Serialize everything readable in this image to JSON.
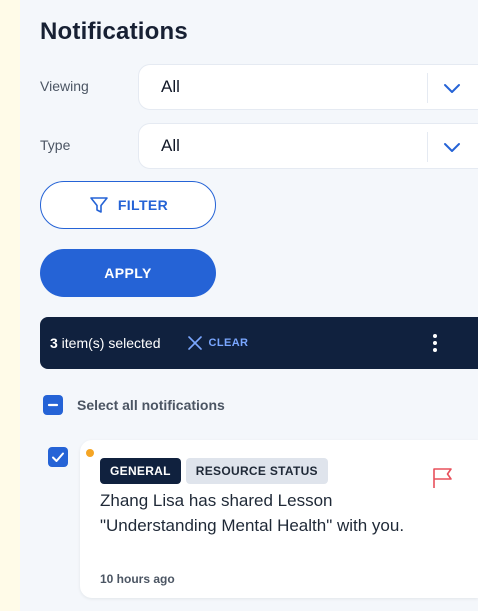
{
  "panel": {
    "title": "Notifications"
  },
  "filters": {
    "viewing": {
      "label": "Viewing",
      "value": "All"
    },
    "type": {
      "label": "Type",
      "value": "All"
    },
    "filter_button": "FILTER",
    "apply_button": "APPLY"
  },
  "selection_bar": {
    "count": "3",
    "suffix": " item(s) selected",
    "clear_label": "CLEAR"
  },
  "select_all": {
    "label": "Select all notifications",
    "state": "indeterminate"
  },
  "notifications": [
    {
      "checked": true,
      "unread": true,
      "badges": [
        "GENERAL",
        "RESOURCE STATUS"
      ],
      "message": "Zhang Lisa has shared Lesson \"Understanding Mental Health\" with you.",
      "time": "10 hours ago",
      "flagged": false
    }
  ],
  "colors": {
    "accent": "#2563d6",
    "dark": "#10213e",
    "unread_dot": "#f5a524",
    "flag": "#e8505b",
    "clear_link": "#7aa7ff"
  },
  "icons": {
    "filter": "filter-funnel-icon",
    "chevron": "chevron-down-icon",
    "clear": "close-icon",
    "more": "more-vertical-icon",
    "flag": "flag-icon",
    "check": "check-icon",
    "indeterminate": "minus-icon"
  }
}
